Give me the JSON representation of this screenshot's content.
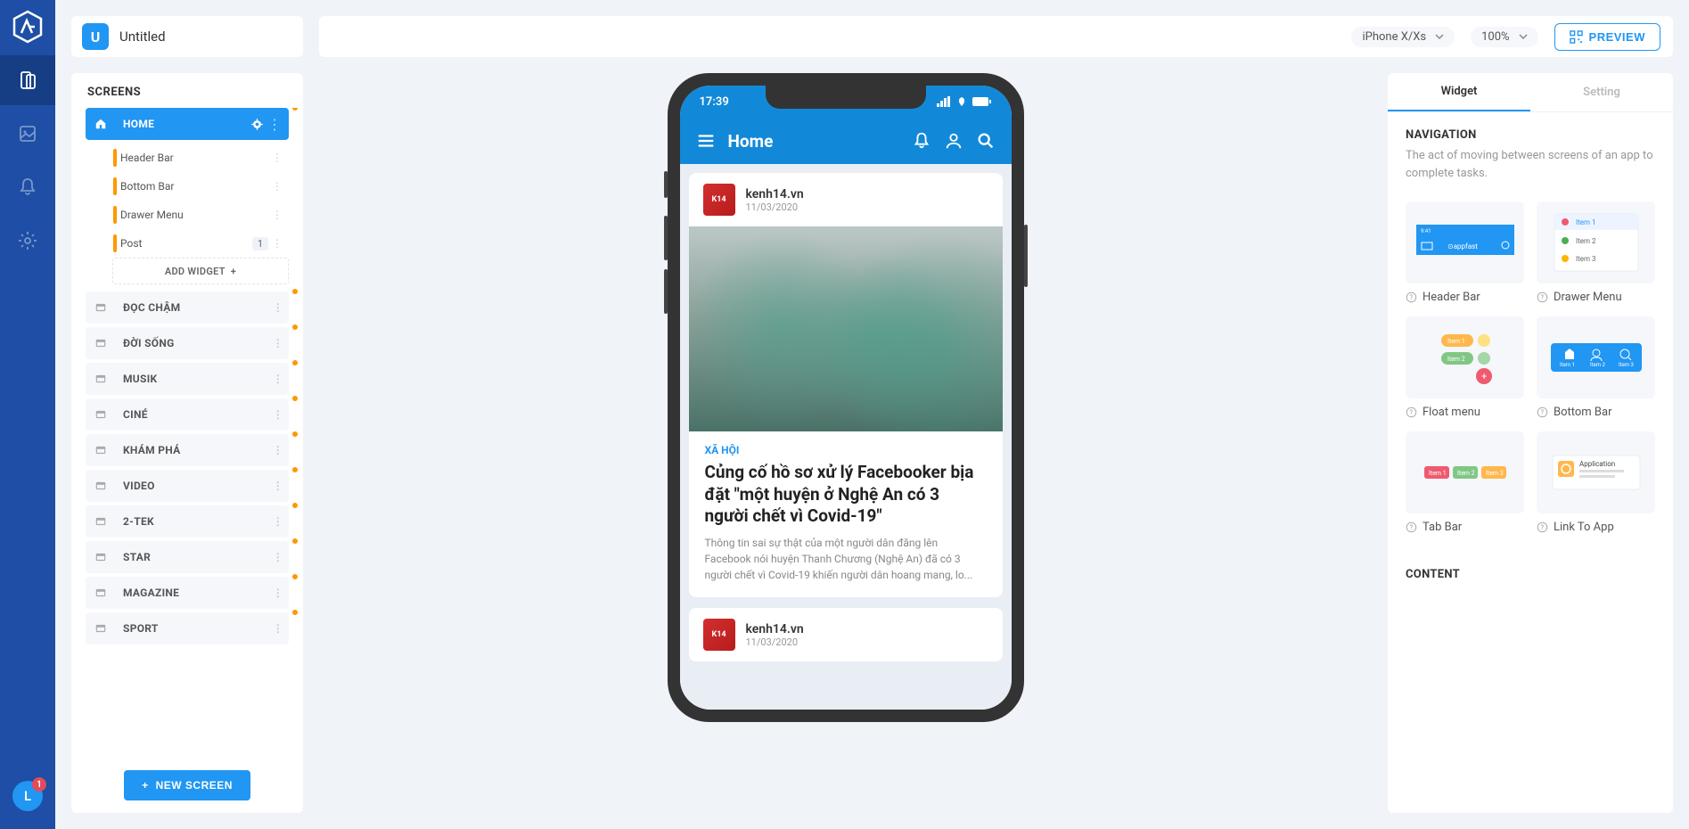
{
  "topbar": {
    "title_initial": "U",
    "title": "Untitled",
    "device": "iPhone X/Xs",
    "zoom": "100%",
    "preview": "PREVIEW"
  },
  "left_rail": {
    "avatar": "L",
    "badge": "1"
  },
  "screens": {
    "header": "SCREENS",
    "home_label": "HOME",
    "children": {
      "header_bar": "Header Bar",
      "bottom_bar": "Bottom Bar",
      "drawer_menu": "Drawer Menu",
      "post": "Post",
      "post_count": "1"
    },
    "add_widget": "ADD WIDGET",
    "list": [
      "ĐỌC CHẬM",
      "ĐỜI SỐNG",
      "MUSIK",
      "CINÉ",
      "KHÁM PHÁ",
      "VIDEO",
      "2-TEK",
      "STAR",
      "MAGAZINE",
      "SPORT"
    ],
    "new_screen": "NEW SCREEN"
  },
  "phone": {
    "time": "17:39",
    "header_title": "Home",
    "post1_source": "kenh14.vn",
    "post1_date": "11/03/2020",
    "post1_category": "XÃ HỘI",
    "post1_title": "Củng cố hồ sơ xử lý Facebooker bịa đặt \"một huyện ở Nghệ An có 3 người chết vì Covid-19\"",
    "post1_desc": "Thông tin sai sự thật của một người dân đăng lên Facebook nói huyện Thanh Chương (Nghệ An) đã có 3 người chết vì Covid-19 khiến người dân hoang mang, lo...",
    "post2_source": "kenh14.vn",
    "post2_date": "11/03/2020"
  },
  "right": {
    "tab_widget": "Widget",
    "tab_setting": "Setting",
    "nav_title": "NAVIGATION",
    "nav_desc": "The act of moving between screens of an app to complete tasks.",
    "widgets": {
      "header_bar": "Header Bar",
      "drawer_menu": "Drawer Menu",
      "float_menu": "Float menu",
      "bottom_bar": "Bottom Bar",
      "tab_bar": "Tab Bar",
      "link_to_app": "Link To App"
    },
    "drawer_preview": {
      "i1": "Item 1",
      "i2": "Item 2",
      "i3": "Item 3"
    },
    "float_preview": {
      "i1": "Item 1",
      "i2": "Item 2"
    },
    "bottom_preview": {
      "i1": "Item 1",
      "i2": "Item 2",
      "i3": "Item 3"
    },
    "tab_preview": {
      "i1": "Item 1",
      "i2": "Item 2",
      "i3": "Item 3"
    },
    "link_preview": {
      "title": "Application"
    },
    "content_title": "CONTENT"
  }
}
